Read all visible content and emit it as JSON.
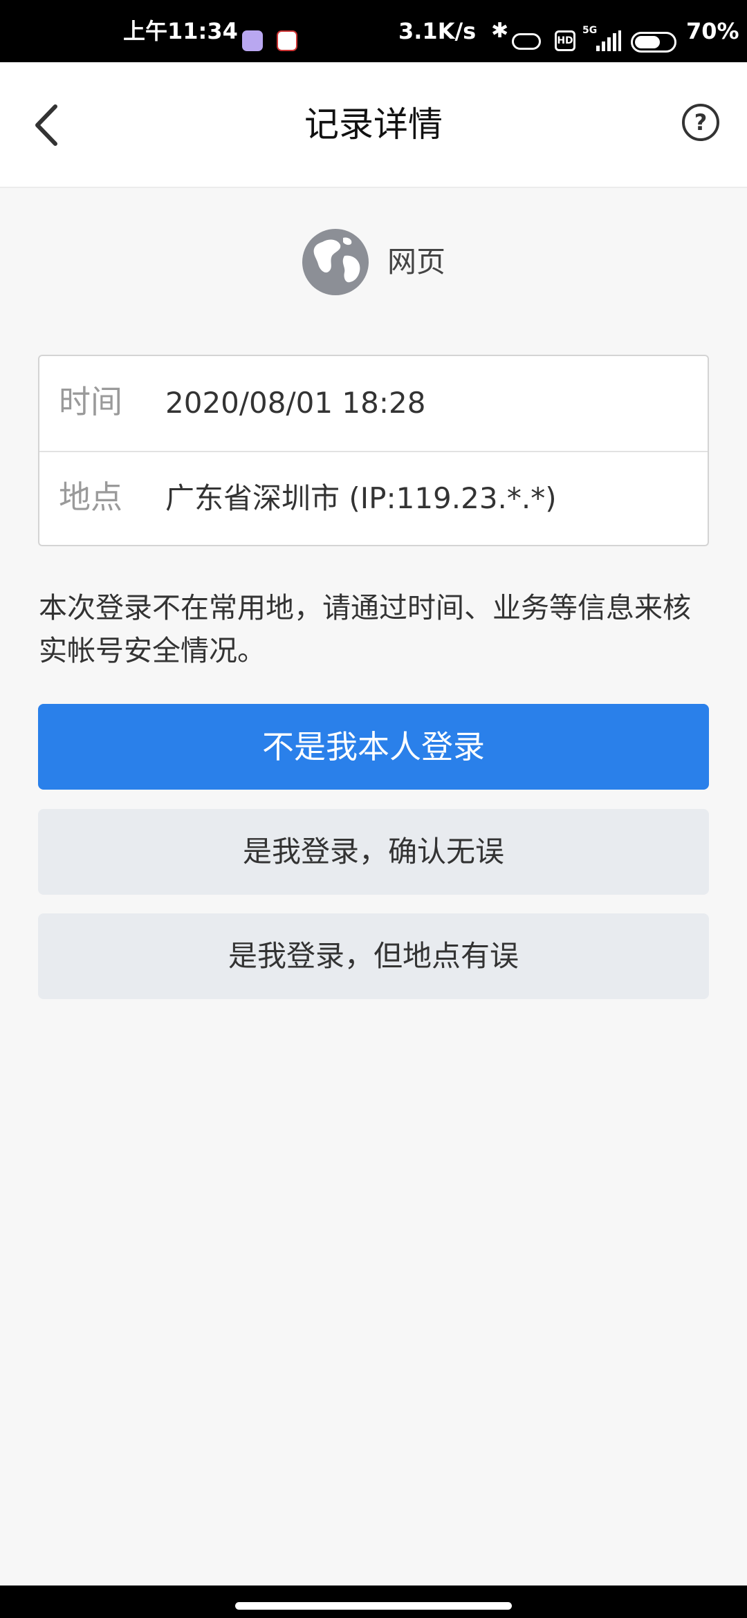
{
  "status_bar": {
    "time": "上午11:34",
    "net_speed": "3.1K/s",
    "hd_label": "HD",
    "network": "5G",
    "battery": "70%",
    "battery_level": 0.7
  },
  "header": {
    "title": "记录详情"
  },
  "source": {
    "label": "网页"
  },
  "details": [
    {
      "key": "时间",
      "value": "2020/08/01 18:28"
    },
    {
      "key": "地点",
      "value": "广东省深圳市 (IP:119.23.*.*)"
    }
  ],
  "notice": "本次登录不在常用地，请通过时间、业务等信息来核实帐号安全情况。",
  "buttons": {
    "not_me": "不是我本人登录",
    "confirm": "是我登录，确认无误",
    "wrong_location": "是我登录，但地点有误"
  }
}
